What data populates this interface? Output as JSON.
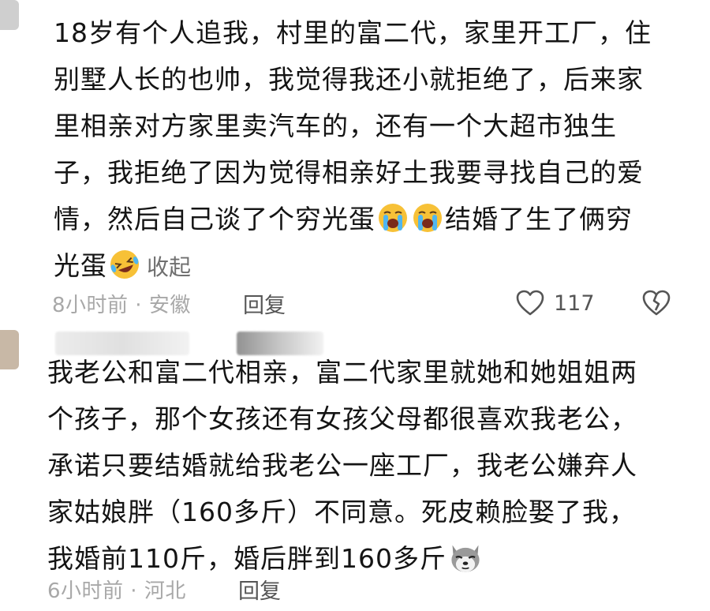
{
  "comments": [
    {
      "lines": [
        "18岁有个人追我，村里的富二代，家里开工厂，住",
        "别墅人长的也帅，我觉得我还小就拒绝了，后来家",
        "里相亲对方家里卖汽车的，还有一个大超市独生",
        "子，我拒绝了因为觉得相亲好土我要寻找自己的爱"
      ],
      "line5_before_emoji": "情，然后自己谈了个穷光蛋",
      "line5_after_emoji": "结婚了生了俩穷",
      "line6_before_emoji": "光蛋",
      "collapse_label": "收起",
      "meta": "8小时前 · 安徽",
      "reply_label": "回复",
      "like_count": "117",
      "emojis": [
        "crying-face-emoji",
        "crying-face-emoji",
        "laughing-tears-emoji"
      ]
    },
    {
      "lines": [
        "我老公和富二代相亲，富二代家里就她和她姐姐两",
        "个孩子，那个女孩还有女孩父母都很喜欢我老公，",
        "承诺只要结婚就给我老公一座工厂，我老公嫌弃人",
        "家姑娘胖（160多斤）不同意。死皮赖脸娶了我，"
      ],
      "line5_before_emoji": "我婚前110斤，婚后胖到160多斤",
      "meta": "6小时前 · 河北",
      "reply_label": "回复",
      "emojis": [
        "husky-dog-emoji"
      ]
    }
  ],
  "colors": {
    "text": "#141414",
    "meta": "#a8a8a8",
    "action": "#555555",
    "emoji_yellow": "#f7c137"
  },
  "icons": [
    "heart-outline-icon",
    "broken-heart-icon"
  ]
}
